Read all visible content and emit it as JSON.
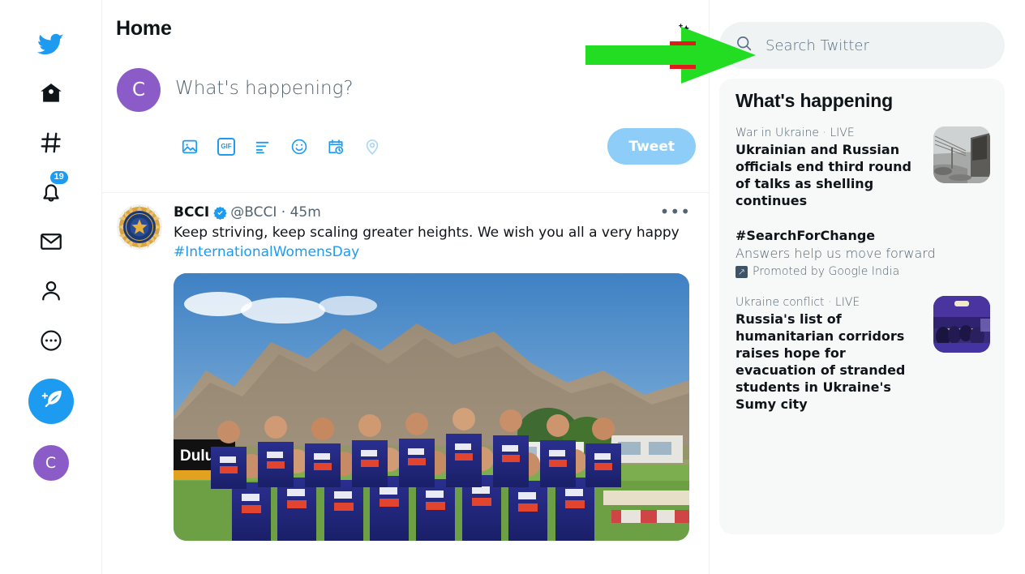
{
  "sidebar": {
    "items": [
      {
        "name": "twitter-logo",
        "icon": "twitter-bird-icon",
        "label": "Twitter"
      },
      {
        "name": "home",
        "icon": "home-icon",
        "label": "Home"
      },
      {
        "name": "explore",
        "icon": "hashtag-icon",
        "label": "Explore"
      },
      {
        "name": "notifications",
        "icon": "bell-icon",
        "label": "Notifications",
        "badge": "19"
      },
      {
        "name": "messages",
        "icon": "envelope-icon",
        "label": "Messages"
      },
      {
        "name": "profile",
        "icon": "person-icon",
        "label": "Profile"
      },
      {
        "name": "more",
        "icon": "more-dots-icon",
        "label": "More"
      }
    ],
    "compose_fab_label": "Tweet",
    "avatar_initial": "C"
  },
  "header": {
    "title": "Home",
    "sparkle_icon": "sparkle-star-icon"
  },
  "compose": {
    "avatar_initial": "C",
    "placeholder": "What's happening?",
    "tools": [
      {
        "name": "media-icon",
        "label": "Media"
      },
      {
        "name": "gif-icon",
        "label": "GIF"
      },
      {
        "name": "poll-icon",
        "label": "Poll"
      },
      {
        "name": "emoji-icon",
        "label": "Emoji"
      },
      {
        "name": "schedule-icon",
        "label": "Schedule"
      },
      {
        "name": "location-icon",
        "label": "Location"
      }
    ],
    "tweet_button": "Tweet"
  },
  "tweet": {
    "author_name": "BCCI",
    "verified": true,
    "handle": "@BCCI",
    "separator": "·",
    "timestamp": "45m",
    "more_glyph": "•••",
    "text": "Keep striving, keep scaling greater heights. We wish you all a very happy",
    "hashtag": "#InternationalWomensDay"
  },
  "search": {
    "placeholder": "Search Twitter",
    "icon": "search-icon"
  },
  "whats_happening": {
    "title": "What's happening",
    "trends": [
      {
        "meta": "War in Ukraine · LIVE",
        "headline": "Ukrainian and Russian officials end third round of talks as shelling continues",
        "has_thumb": true
      },
      {
        "headline": "#SearchForChange",
        "subtitle": "Answers help us move forward",
        "promoted_by": "Promoted by Google India",
        "promoted_icon": "external-link-icon",
        "has_thumb": false
      },
      {
        "meta": "Ukraine conflict · LIVE",
        "headline": "Russia's list of humanitarian corridors raises hope for evacuation of stranded students in Ukraine's Sumy city",
        "has_thumb": true
      }
    ]
  },
  "annotation": {
    "arrow_color": "#22dd22",
    "arrow_target": "search-twitter-box"
  },
  "colors": {
    "brand_blue": "#1d9bf0",
    "tweet_button": "#8ecdf7",
    "avatar_purple": "#8b5cc7",
    "panel_bg": "#f7f9f9",
    "search_bg": "#eff3f4",
    "text_primary": "#0f1419",
    "text_secondary": "#536471"
  }
}
